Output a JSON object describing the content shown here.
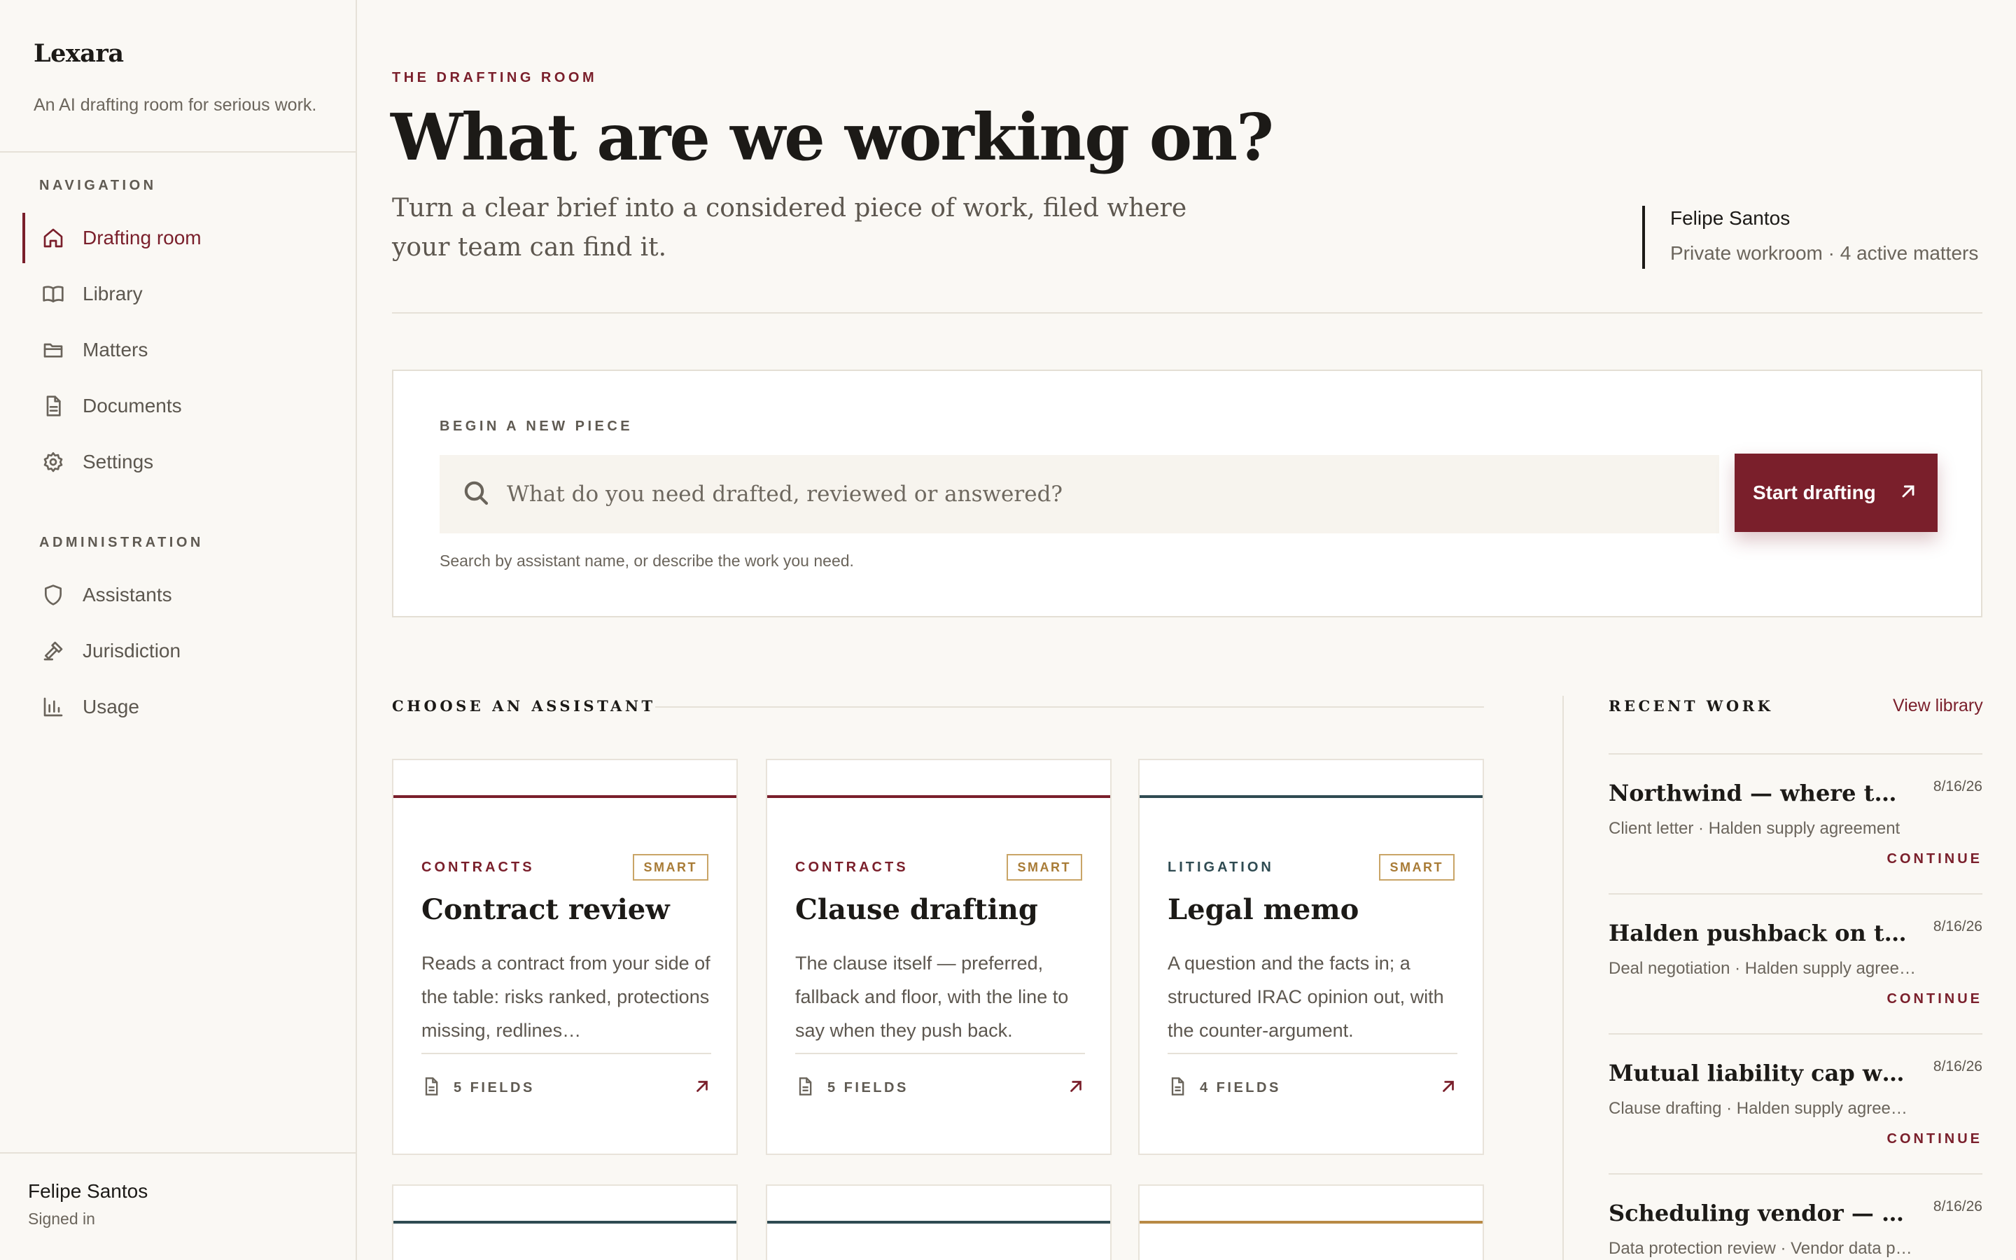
{
  "app": {
    "brand": "Lexara",
    "tagline": "An AI drafting room for serious work."
  },
  "colors": {
    "accent": "#7a1f2b",
    "teal": "#2f4b52",
    "gold": "#b88a45",
    "background": "#faf8f4"
  },
  "sidebar": {
    "nav_heading": "NAVIGATION",
    "nav": [
      {
        "label": "Drafting room",
        "icon": "home-icon",
        "active": true
      },
      {
        "label": "Library",
        "icon": "book-icon"
      },
      {
        "label": "Matters",
        "icon": "folder-icon"
      },
      {
        "label": "Documents",
        "icon": "document-icon"
      },
      {
        "label": "Settings",
        "icon": "gear-icon"
      }
    ],
    "admin_heading": "ADMINISTRATION",
    "admin": [
      {
        "label": "Assistants",
        "icon": "shield-icon"
      },
      {
        "label": "Jurisdiction",
        "icon": "gavel-icon"
      },
      {
        "label": "Usage",
        "icon": "bar-chart-icon"
      }
    ],
    "user": {
      "name": "Felipe Santos",
      "status": "Signed in"
    }
  },
  "header": {
    "eyebrow": "THE DRAFTING ROOM",
    "title": "What are we working on?",
    "subtitle": "Turn a clear brief into a considered piece of work, filed where your team can find it.",
    "profile_name": "Felipe Santos",
    "profile_meta": "Private workroom · 4 active matters"
  },
  "composer": {
    "label": "BEGIN A NEW PIECE",
    "placeholder": "What do you need drafted, reviewed or answered?",
    "button": "Start drafting",
    "hint": "Search by assistant name, or describe the work you need."
  },
  "assistants": {
    "heading": "CHOOSE AN ASSISTANT",
    "cards": [
      {
        "category": "CONTRACTS",
        "badge": "SMART",
        "title": "Contract review",
        "description": "Reads a contract from your side of the table: risks ranked, protections missing, redlines…",
        "fields": "5 FIELDS",
        "accent": "#7a1f2b",
        "category_color": "#7a1f2b"
      },
      {
        "category": "CONTRACTS",
        "badge": "SMART",
        "title": "Clause drafting",
        "description": "The clause itself — preferred, fallback and floor, with the line to say when they push back.",
        "fields": "5 FIELDS",
        "accent": "#7a1f2b",
        "category_color": "#7a1f2b"
      },
      {
        "category": "LITIGATION",
        "badge": "SMART",
        "title": "Legal memo",
        "description": "A question and the facts in; a structured IRAC opinion out, with the counter-argument.",
        "fields": "4 FIELDS",
        "accent": "#2f4b52",
        "category_color": "#2f4b52"
      }
    ],
    "stubs": [
      {
        "accent": "#2f4b52"
      },
      {
        "accent": "#2f4b52"
      },
      {
        "accent": "#b88a45"
      }
    ]
  },
  "recent": {
    "heading": "RECENT WORK",
    "link": "View library",
    "continue_label": "CONTINUE",
    "items": [
      {
        "title": "Northwind — where the Halden matter stands",
        "date": "8/16/26",
        "meta": "Client letter · Halden supply agreement"
      },
      {
        "title": "Halden pushback on the vendor terms",
        "date": "8/16/26",
        "meta": "Deal negotiation · Halden supply agreement"
      },
      {
        "title": "Mutual liability cap with a carve-out",
        "date": "8/16/26",
        "meta": "Clause drafting · Halden supply agreement"
      },
      {
        "title": "Scheduling vendor — processing terms",
        "date": "8/16/26",
        "meta": "Data protection review · Vendor data processing"
      }
    ]
  }
}
